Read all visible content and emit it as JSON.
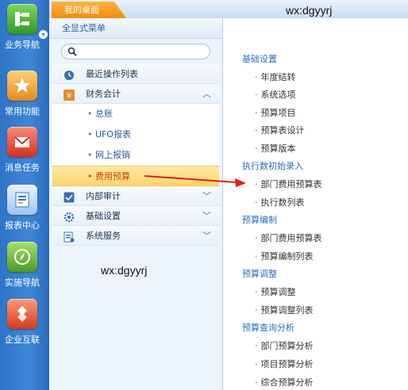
{
  "rail": [
    {
      "name": "business-nav",
      "label": "业务导航",
      "icon": "business-nav-icon",
      "color": "#46b03a"
    },
    {
      "name": "common-functions",
      "label": "常用功能",
      "icon": "star-icon",
      "color": "#f0a43a"
    },
    {
      "name": "message-tasks",
      "label": "消息任务",
      "icon": "mail-icon",
      "color": "#e24a3a"
    },
    {
      "name": "report-center",
      "label": "报表中心",
      "icon": "report-icon",
      "color": "#6aa6e6"
    },
    {
      "name": "implementation-nav",
      "label": "实施导航",
      "icon": "compass-icon",
      "color": "#6db63a"
    },
    {
      "name": "enterprise-interconnect",
      "label": "企业互联",
      "icon": "puzzle-icon",
      "color": "#e8543c"
    }
  ],
  "topbar": {
    "tab_home": "我的桌面",
    "watermark": "wx:dgyyrj"
  },
  "menu": {
    "header": "全显式菜单",
    "search_placeholder": "",
    "recent": "最近操作列表",
    "finance": "财务会计",
    "finance_items": [
      "总账",
      "UFO报表",
      "网上报销",
      "费用预算"
    ],
    "internal_audit": "内部审计",
    "basic_settings": "基础设置",
    "system_services": "系统服务",
    "watermark": "wx:dgyyrj"
  },
  "content": {
    "sections": [
      {
        "title": "基础设置",
        "items": [
          "年度结转",
          "系统选项",
          "预算项目",
          "预算表设计",
          "预算版本"
        ]
      },
      {
        "title": "执行数初始录入",
        "items": [
          "部门费用预算表",
          "执行数列表"
        ]
      },
      {
        "title": "预算编制",
        "items": [
          "部门费用预算表",
          "预算编制列表"
        ]
      },
      {
        "title": "预算调整",
        "items": [
          "预算调整",
          "预算调整列表"
        ]
      },
      {
        "title": "预算查询分析",
        "items": [
          "部门预算分析",
          "项目预算分析",
          "综合预算分析"
        ]
      }
    ]
  },
  "colors": {
    "accent": "#2a6fbe",
    "active_bg": "#ffd36b",
    "active_text": "#c4470a",
    "arrow": "#e02020",
    "tab": "#f08d10"
  }
}
